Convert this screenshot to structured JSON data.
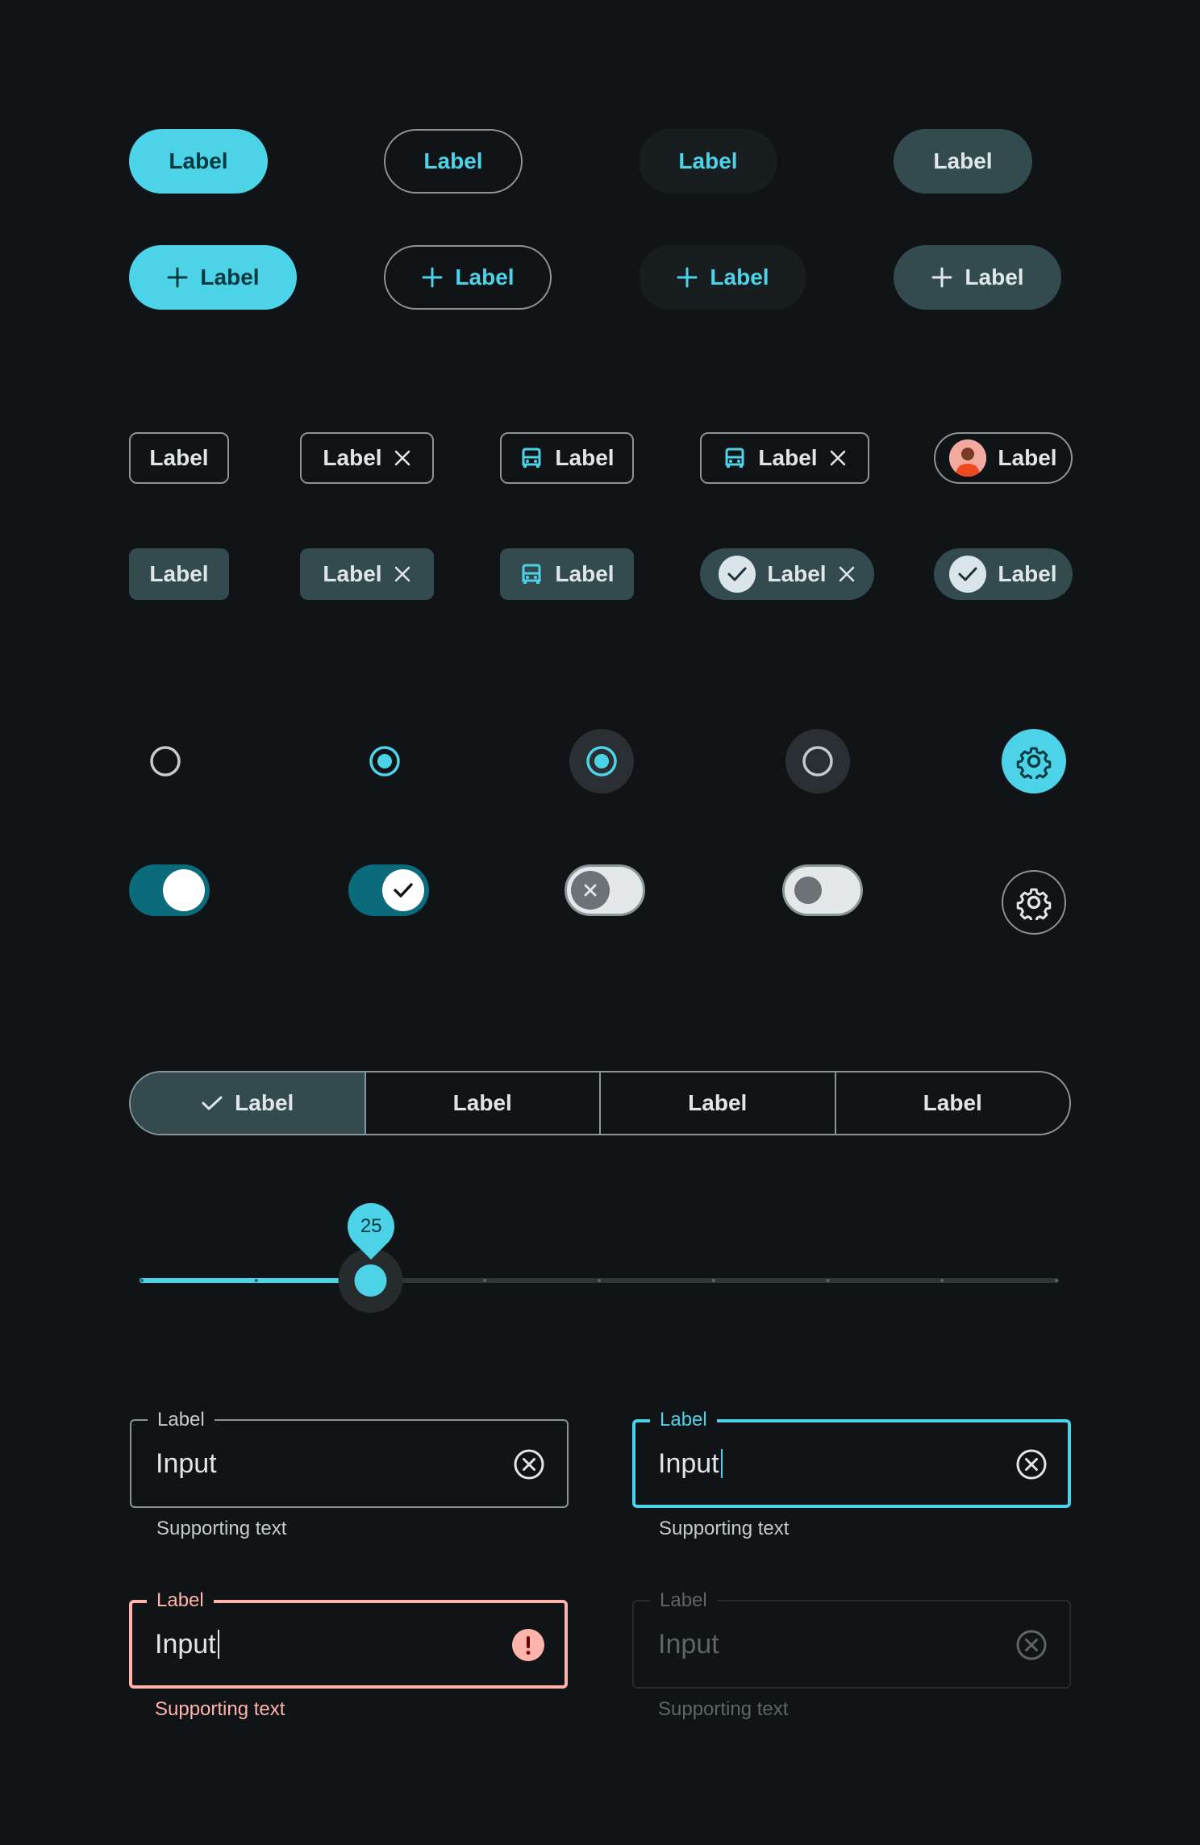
{
  "buttons": {
    "row1": [
      "Label",
      "Label",
      "Label",
      "Label"
    ],
    "row2": [
      "Label",
      "Label",
      "Label",
      "Label"
    ],
    "plus_icon": "add-icon"
  },
  "chips": {
    "row1": [
      "Label",
      "Label",
      "Label",
      "Label",
      "Label"
    ],
    "row2": [
      "Label",
      "Label",
      "Label",
      "Label",
      "Label"
    ]
  },
  "segmented": {
    "items": [
      "Label",
      "Label",
      "Label",
      "Label"
    ],
    "selected_index": 0
  },
  "slider": {
    "value": "25",
    "value_fraction": 0.25,
    "ticks": 9
  },
  "fields": {
    "default": {
      "label": "Label",
      "value": "Input",
      "supporting": "Supporting text"
    },
    "focused": {
      "label": "Label",
      "value": "Input",
      "supporting": "Supporting text"
    },
    "error": {
      "label": "Label",
      "value": "Input",
      "supporting": "Supporting text"
    },
    "disabled": {
      "label": "Label",
      "value": "Input",
      "supporting": "Supporting text"
    }
  },
  "colors": {
    "primary": "#4dd3e7",
    "tonal": "#334a4f",
    "background": "#101416",
    "outline": "#8a9598",
    "error": "#ffb4ab"
  }
}
